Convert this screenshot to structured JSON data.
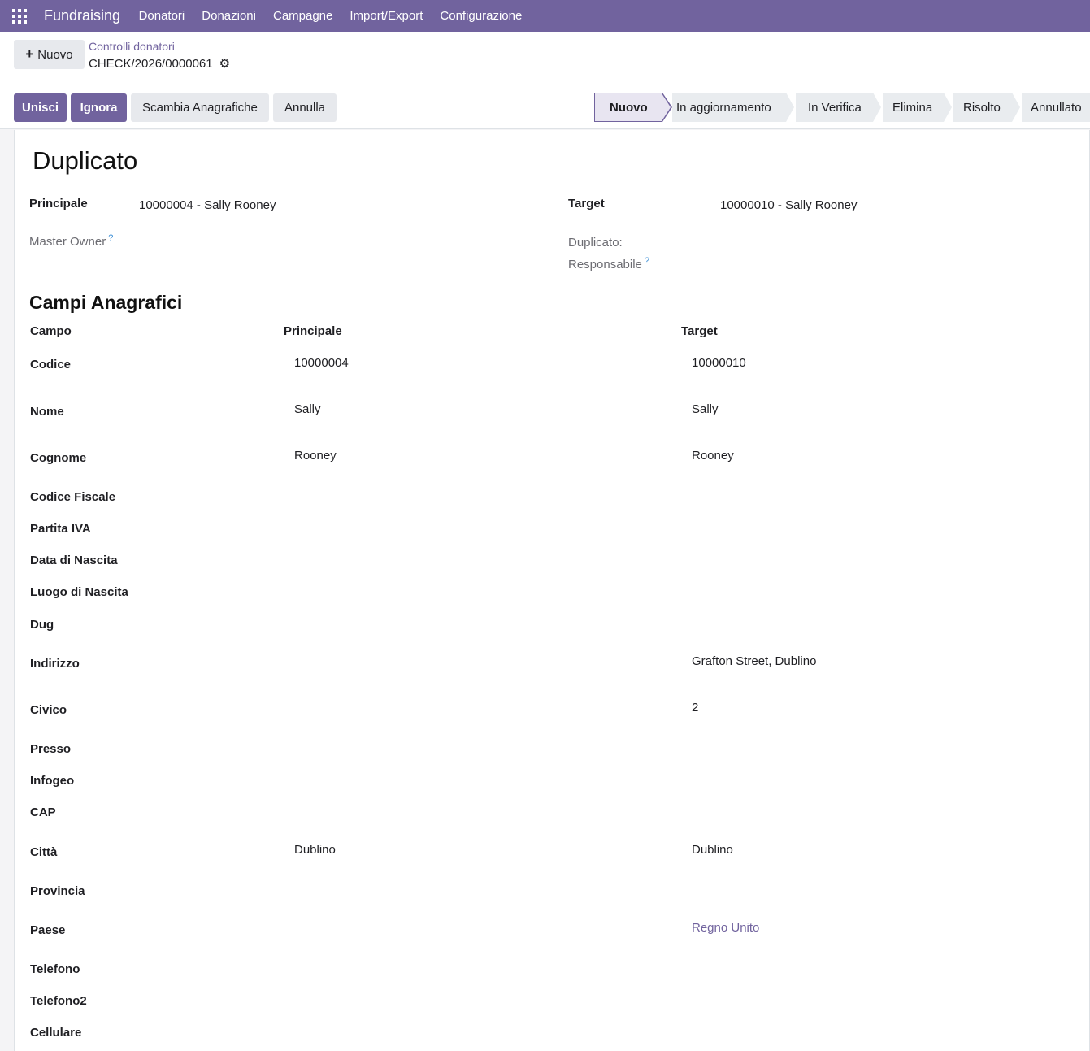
{
  "nav": {
    "brand": "Fundraising",
    "menu": [
      "Donatori",
      "Donazioni",
      "Campagne",
      "Import/Export",
      "Configurazione"
    ]
  },
  "control": {
    "new_label": "Nuovo",
    "breadcrumb": "Controlli donatori",
    "record": "CHECK/2026/0000061"
  },
  "actions": {
    "merge": "Unisci",
    "ignore": "Ignora",
    "swap": "Scambia Anagrafiche",
    "cancel": "Annulla"
  },
  "stages": [
    "Nuovo",
    "In aggiornamento",
    "In Verifica",
    "Elimina",
    "Risolto",
    "Annullato"
  ],
  "active_stage": "Nuovo",
  "form": {
    "title": "Duplicato",
    "principale_label": "Principale",
    "principale_value": "10000004 - Sally Rooney",
    "target_label": "Target",
    "target_value": "10000010 - Sally Rooney",
    "master_owner_label": "Master Owner",
    "resp_label_1": "Duplicato:",
    "resp_label_2": "Responsabile",
    "help_mark": "?"
  },
  "fields_section": {
    "title": "Campi Anagrafici",
    "headers": {
      "campo": "Campo",
      "principale": "Principale",
      "target": "Target"
    },
    "rows": [
      {
        "label": "Codice",
        "principale": "10000004",
        "target": "10000010"
      },
      {
        "label": "Nome",
        "principale": "Sally",
        "target": "Sally"
      },
      {
        "label": "Cognome",
        "principale": "Rooney",
        "target": "Rooney"
      },
      {
        "label": "Codice Fiscale",
        "principale": "",
        "target": ""
      },
      {
        "label": "Partita IVA",
        "principale": "",
        "target": ""
      },
      {
        "label": "Data di Nascita",
        "principale": "",
        "target": ""
      },
      {
        "label": "Luogo di Nascita",
        "principale": "",
        "target": ""
      },
      {
        "label": "Dug",
        "principale": "",
        "target": ""
      },
      {
        "label": "Indirizzo",
        "principale": "",
        "target": "Grafton Street, Dublino"
      },
      {
        "label": "Civico",
        "principale": "",
        "target": "2"
      },
      {
        "label": "Presso",
        "principale": "",
        "target": ""
      },
      {
        "label": "Infogeo",
        "principale": "",
        "target": ""
      },
      {
        "label": "CAP",
        "principale": "",
        "target": ""
      },
      {
        "label": "Città",
        "principale": "Dublino",
        "target": "Dublino"
      },
      {
        "label": "Provincia",
        "principale": "",
        "target": ""
      },
      {
        "label": "Paese",
        "principale": "",
        "target": "Regno Unito"
      },
      {
        "label": "Telefono",
        "principale": "",
        "target": ""
      },
      {
        "label": "Telefono2",
        "principale": "",
        "target": ""
      },
      {
        "label": "Cellulare",
        "principale": "",
        "target": ""
      }
    ]
  },
  "colors": {
    "brand": "#71639e",
    "link": "#71639e",
    "help": "#3d8fd6"
  }
}
